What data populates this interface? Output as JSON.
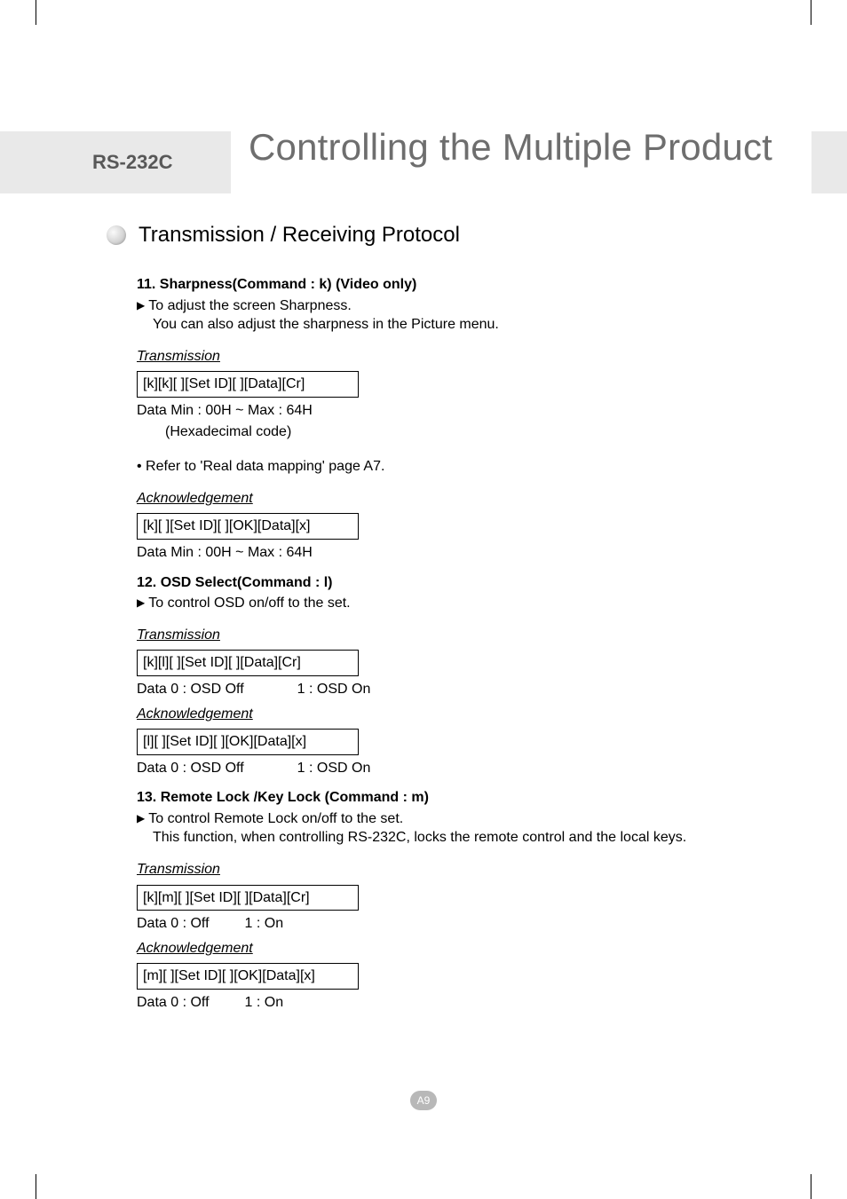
{
  "header": {
    "prefix": "RS-232C",
    "title": "Controlling the Multiple Product"
  },
  "section": {
    "title": "Transmission / Receiving Protocol"
  },
  "cmd11": {
    "title": "11. Sharpness(Command : k) (Video only)",
    "desc1": "To adjust the screen Sharpness.",
    "desc2": "You can also adjust the sharpness in the Picture menu.",
    "tx_label": "Transmission",
    "tx_code": "[k][k][ ][Set ID][ ][Data][Cr]",
    "tx_data1": "Data      Min : 00H ~ Max : 64H",
    "tx_data2": "(Hexadecimal code)",
    "note": "• Refer to 'Real data mapping' page A7.",
    "ack_label": "Acknowledgement",
    "ack_code": "[k][ ][Set ID][ ][OK][Data][x]",
    "ack_data": "Data       Min : 00H ~ Max : 64H"
  },
  "cmd12": {
    "title": "12. OSD Select(Command : l)",
    "desc1": "To control OSD on/off to the set.",
    "tx_label": "Transmission",
    "tx_code": "[k][l][ ][Set ID][ ][Data][Cr]",
    "tx_data_a": "Data 0 : OSD Off",
    "tx_data_b": "1 : OSD On",
    "ack_label": "Acknowledgement",
    "ack_code": "[l][ ][Set ID][ ][OK][Data][x]",
    "ack_data_a": "Data 0 : OSD Off",
    "ack_data_b": "1 : OSD On"
  },
  "cmd13": {
    "title": "13. Remote Lock /Key Lock (Command : m)",
    "desc1": "To control Remote Lock on/off to the set.",
    "desc2": "This function, when controlling RS-232C, locks the remote control and the local keys.",
    "tx_label": "Transmission",
    "tx_code": "[k][m][ ][Set ID][ ][Data][Cr]",
    "tx_data_a": "Data 0 : Off",
    "tx_data_b": "1 : On",
    "ack_label": "Acknowledgement",
    "ack_code": "[m][ ][Set ID][ ][OK][Data][x]",
    "ack_data_a": "Data 0 : Off",
    "ack_data_b": "1 : On"
  },
  "page": "A9"
}
